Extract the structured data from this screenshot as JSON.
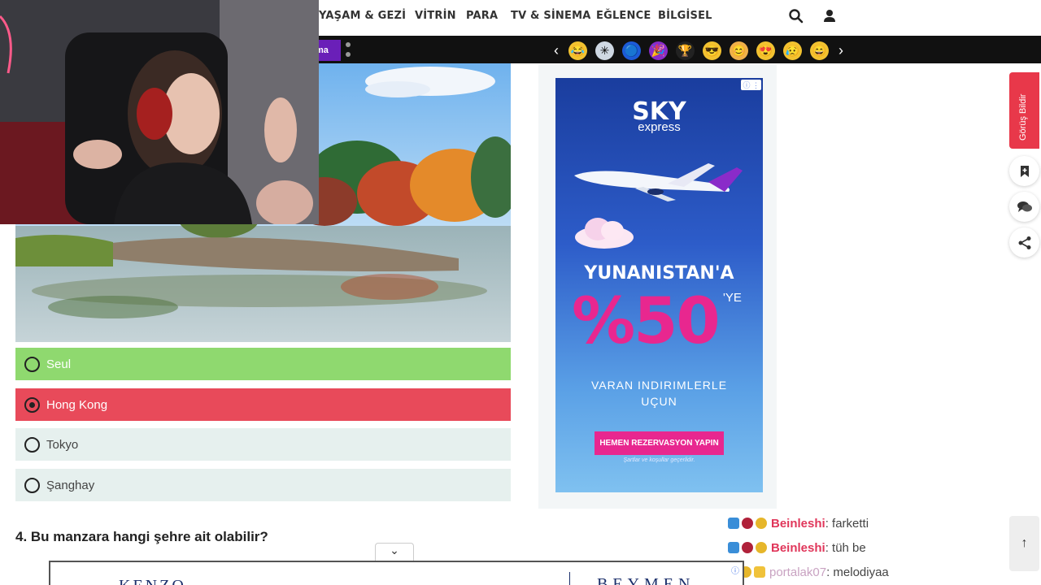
{
  "nav": {
    "items": [
      "YAŞAM & GEZİ",
      "VİTRİN",
      "PARA",
      "TV & SİNEMA",
      "EĞLENCE",
      "BİLGİSEL"
    ],
    "search_icon": "search-icon",
    "user_icon": "user-icon"
  },
  "category_bar": {
    "tag_label": "ma",
    "prev_label": "‹",
    "next_label": "›",
    "emojis": [
      "😂",
      "✳",
      "🔵",
      "🎉",
      "🏆",
      "😎",
      "😊",
      "😍",
      "😥",
      "😄"
    ]
  },
  "quiz": {
    "answers": [
      {
        "label": "Seul",
        "state": "correct",
        "selected": false
      },
      {
        "label": "Hong Kong",
        "state": "wrong",
        "selected": true
      },
      {
        "label": "Tokyo",
        "state": "neutral",
        "selected": false
      },
      {
        "label": "Şanghay",
        "state": "neutral",
        "selected": false
      }
    ],
    "next_question": "4. Bu manzara hangi şehre ait olabilir?"
  },
  "ad": {
    "brand": "SKY",
    "brand_sub": "express",
    "headline": "YUNANISTAN'A",
    "percent": "%50",
    "suffix": "'YE",
    "line1": "VARAN INDIRIMLERLE",
    "line2": "UÇUN",
    "cta": "HEMEN REZERVASYON YAPIN",
    "terms": "Şartlar ve koşullar geçerlidir.",
    "badge": "ⓘ ⋮"
  },
  "sidebar": {
    "feedback_label": "Görüş Bildir",
    "up_label": "↑"
  },
  "chat": [
    {
      "user": "Beinleshi",
      "message": ": farketti"
    },
    {
      "user": "Beinleshi",
      "message": ": tüh be"
    },
    {
      "user": "portalak07",
      "message": ": melodiyaa"
    }
  ],
  "bottom_ad": {
    "toggle": "⌄",
    "brand_left": "KENZO",
    "brand_right": "BEYMEN",
    "info": "ⓘ"
  },
  "colors": {
    "correct": "#8fd96f",
    "wrong": "#e84a5a",
    "neutral": "#e6f0ee",
    "feedback": "#e8384a",
    "ad_pink": "#e8278f"
  }
}
